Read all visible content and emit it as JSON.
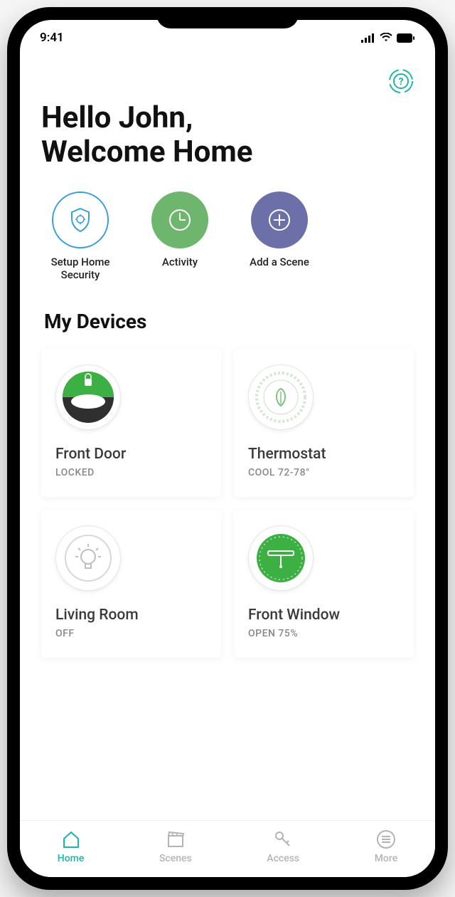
{
  "status": {
    "time": "9:41"
  },
  "greeting": {
    "line1": "Hello John,",
    "line2": "Welcome Home"
  },
  "quick_actions": [
    {
      "label": "Setup Home Security"
    },
    {
      "label": "Activity"
    },
    {
      "label": "Add a Scene"
    }
  ],
  "devices_section_title": "My Devices",
  "devices": [
    {
      "name": "Front Door",
      "status": "LOCKED"
    },
    {
      "name": "Thermostat",
      "status": "COOL 72-78°"
    },
    {
      "name": "Living Room",
      "status": "OFF"
    },
    {
      "name": "Front Window",
      "status": "OPEN 75%"
    }
  ],
  "tabs": [
    {
      "label": "Home",
      "active": true
    },
    {
      "label": "Scenes",
      "active": false
    },
    {
      "label": "Access",
      "active": false
    },
    {
      "label": "More",
      "active": false
    }
  ],
  "colors": {
    "teal": "#1fb6a6",
    "green": "#6eb66e",
    "purple": "#6c6fa8",
    "blue": "#3a9fd8"
  }
}
